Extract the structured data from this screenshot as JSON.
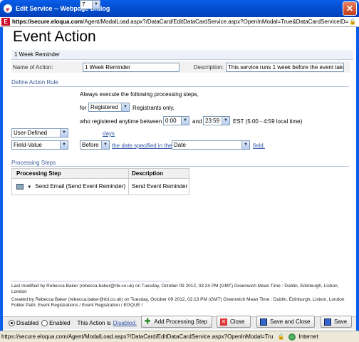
{
  "window": {
    "title": "Edit Service -- Webpage Dialog"
  },
  "address": {
    "host": "https://secure.eloqua.com",
    "path": "/Agent/ModalLoad.aspx?/DataCard/EditDataCardService.aspx?OpenInModal=True&DataCardServiceID="
  },
  "page": {
    "heading": "Event Action",
    "subtitle": "1 Week Reminder",
    "name_label": "Name of Action:",
    "name_value": "1 Week Reminder",
    "desc_label": "Description:",
    "desc_value": "This service runs 1 week before the event take"
  },
  "rule": {
    "section_title": "Define Action Rule",
    "always_text": "Always execute the following processing steps,",
    "for_text": "for",
    "registrant_status": "Registered",
    "registrants_only": "Registrants only,",
    "who_registered": "who registered anytime between",
    "time_from": "0:00",
    "and_text": "and",
    "time_to": "23:59",
    "tz_text": "EST  (5:00 - 4:59 local time)",
    "left_select_1": "User-Defined",
    "days_value": "7",
    "days_link": "days",
    "left_select_2": "Field-Value",
    "before_value": "Before",
    "date_link": "the date specified in the",
    "date_field": "Date",
    "field_link": "field."
  },
  "steps": {
    "section_title": "Processing Steps",
    "col_step": "Processing Step",
    "col_desc": "Description",
    "rows": [
      {
        "step": "Send Email (Send Event Reminder)",
        "desc": "Send Event Reminder"
      }
    ]
  },
  "meta": {
    "modified": "Last modified by Rebecca Baker (rebecca.baker@rbi.co.uk) on Tuesday, October 09 2012, 03:24 PM (GMT) Greenwich Mean Time : Dublin, Edinburgh, Lisbon, London",
    "created": "Created by Rebecca Baker (rebecca.baker@rbi.co.uk) on Tuesday, October 09 2012, 02:13 PM (GMT) Greenwich Mean Time : Dublin, Edinburgh, Lisbon, London",
    "folder": "Folder Path: Event Registrations / Event Registration / EGQUE /"
  },
  "actions": {
    "disabled_label": "Disabled",
    "enabled_label": "Enabled",
    "status_prefix": "This Action is",
    "status_link": "Disabled.",
    "add_step": "Add Processing Step",
    "close": "Close",
    "save_close": "Save and Close",
    "save": "Save"
  },
  "status": {
    "url": "https://secure.eloqua.com/Agent/ModalLoad.aspx?/DataCard/EditDataCardService.aspx?OpenInModal=Tru",
    "zone": "Internet"
  },
  "colors": {
    "title_bar": "#0350d4",
    "section_title": "#3a5a98",
    "link": "#3355aa"
  }
}
